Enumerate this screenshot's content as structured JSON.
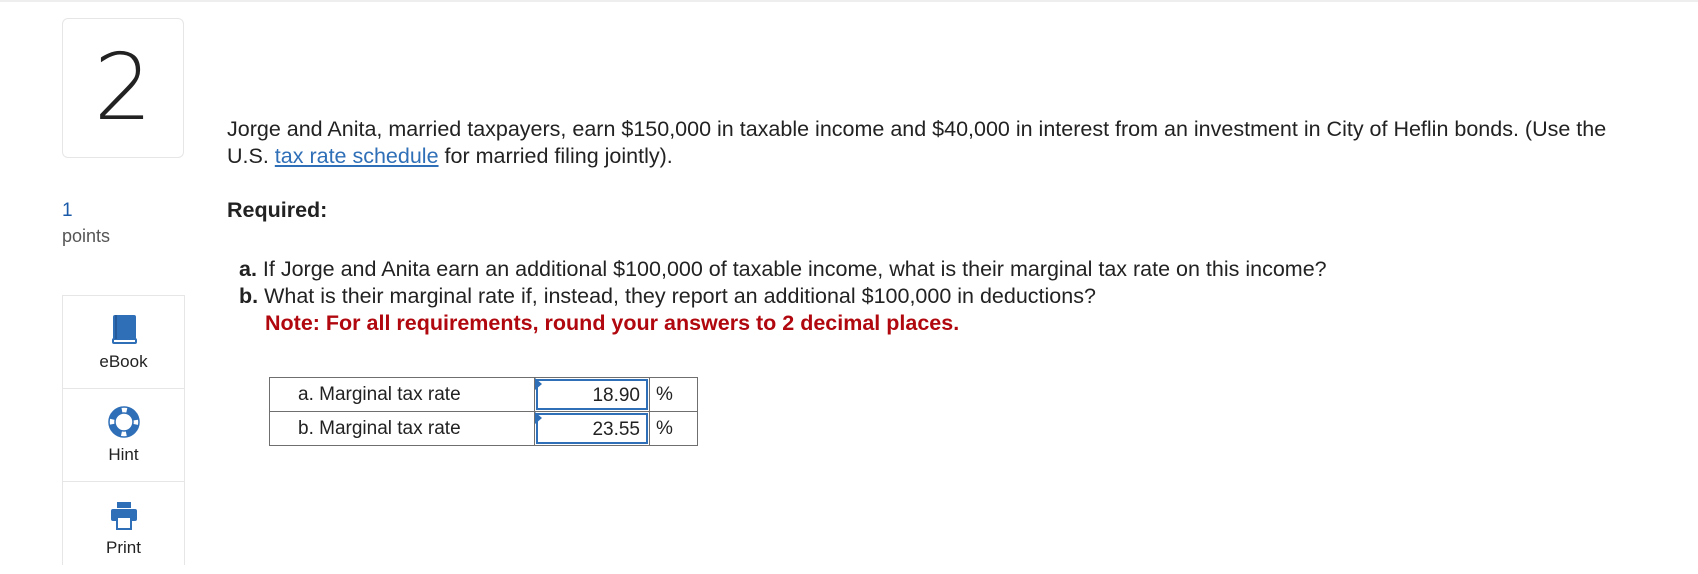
{
  "question_number": "2",
  "points": {
    "value": "1",
    "label": "points"
  },
  "tools": [
    {
      "label": "eBook",
      "icon": "book-icon"
    },
    {
      "label": "Hint",
      "icon": "lifebuoy-icon"
    },
    {
      "label": "Print",
      "icon": "printer-icon"
    }
  ],
  "question": {
    "text_before": "Jorge and Anita, married taxpayers, earn $150,000 in taxable income and $40,000 in interest from an investment in City of Heflin bonds. (Use the U.S. ",
    "link_text": "tax rate schedule",
    "text_after": " for married filing jointly)."
  },
  "required_label": "Required:",
  "requirements": [
    {
      "label": "a.",
      "text": "If Jorge and Anita earn an additional $100,000 of taxable income, what is their marginal tax rate on this income?"
    },
    {
      "label": "b.",
      "text": "What is their marginal rate if, instead, they report an additional $100,000 in deductions?"
    }
  ],
  "note": "Note: For all requirements, round your answers to 2 decimal places.",
  "answers": [
    {
      "label": "a. Marginal tax rate",
      "value": "18.90",
      "unit": "%"
    },
    {
      "label": "b. Marginal tax rate",
      "value": "23.55",
      "unit": "%"
    }
  ],
  "colors": {
    "link": "#2f6fb7",
    "note": "#b0080e",
    "points": "#1a5aa8"
  }
}
